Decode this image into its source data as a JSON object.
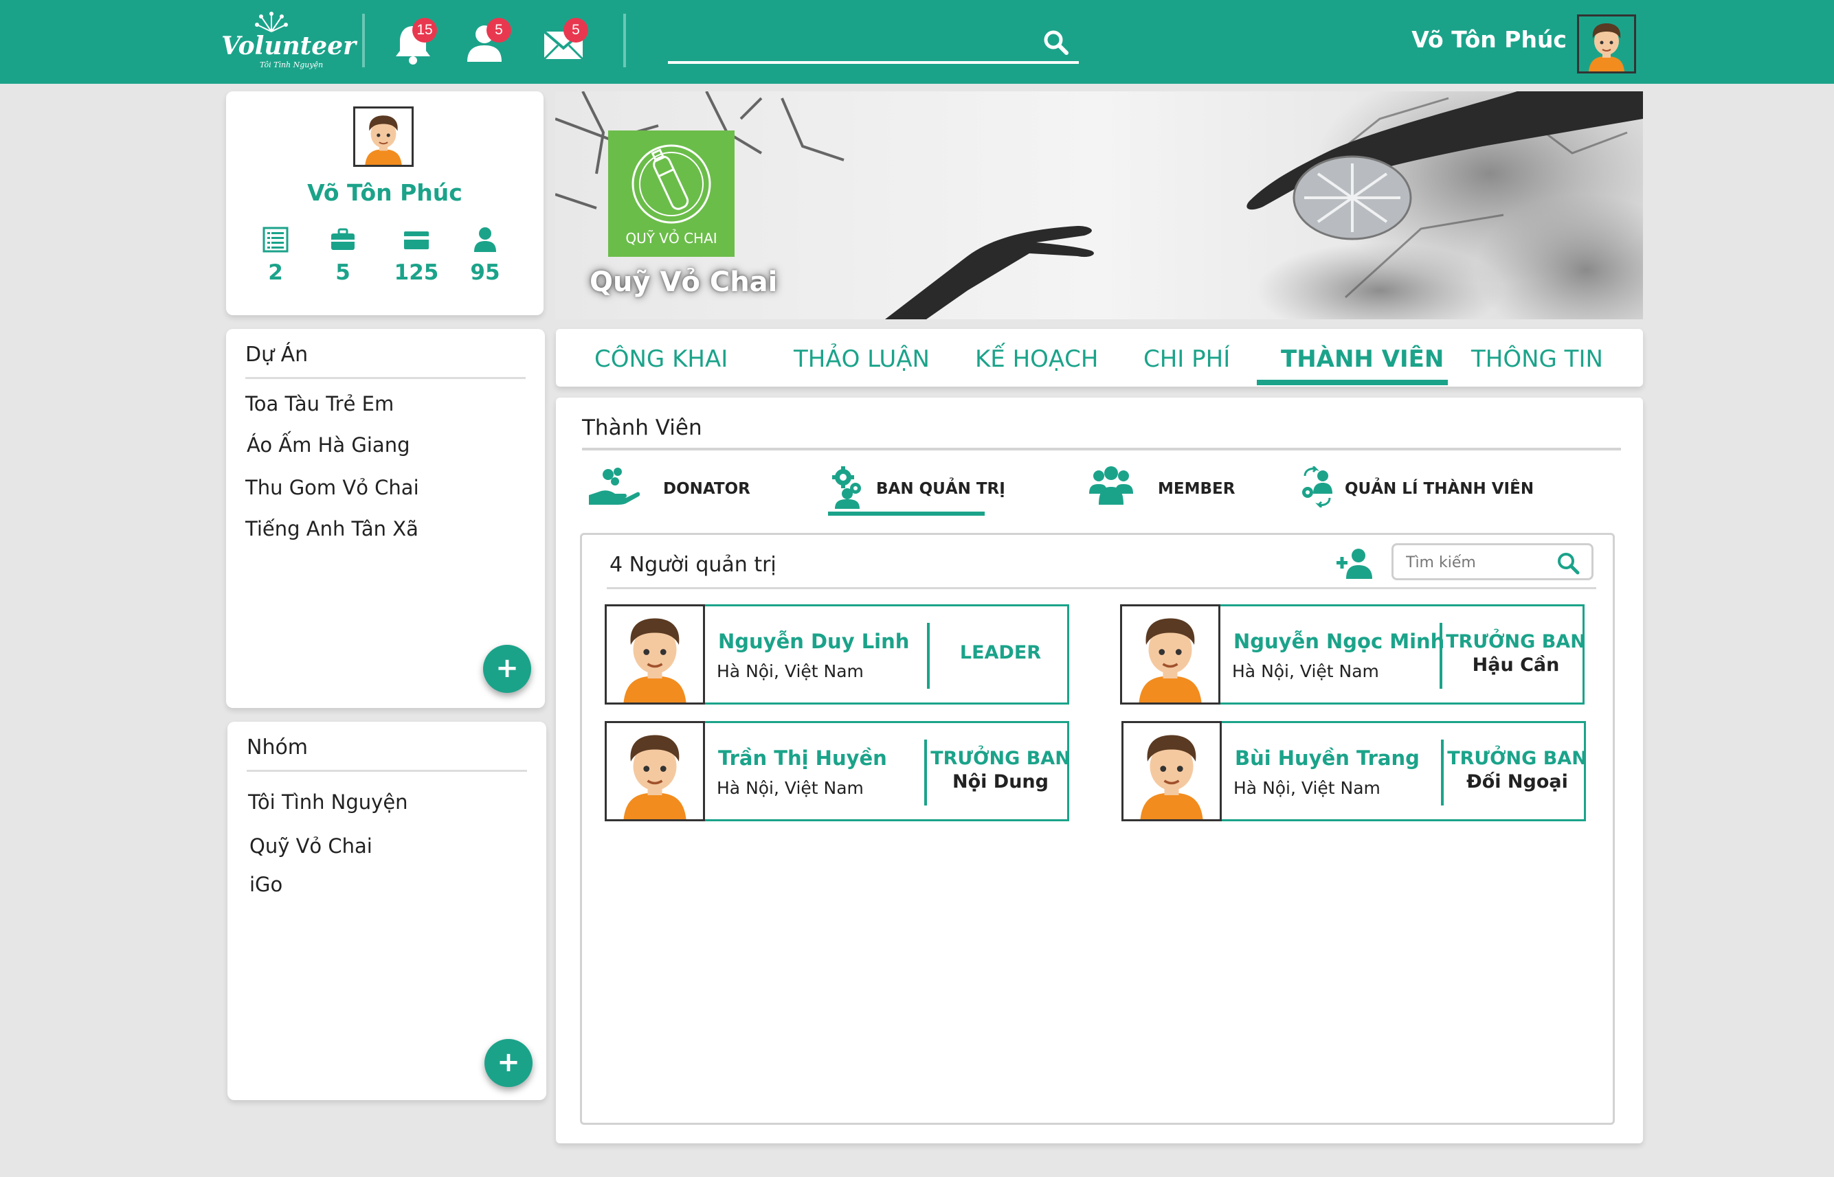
{
  "brand": {
    "logo_text": "Volunteer",
    "logo_subtitle": "Tôi Tình Nguyện"
  },
  "header": {
    "notifications_count": "15",
    "friend_requests_count": "5",
    "messages_count": "5",
    "search_placeholder": "",
    "username": "Võ Tôn Phúc"
  },
  "profile": {
    "name": "Võ Tôn Phúc",
    "stats": [
      {
        "icon": "list-icon",
        "value": "2"
      },
      {
        "icon": "briefcase-icon",
        "value": "5"
      },
      {
        "icon": "card-icon",
        "value": "125"
      },
      {
        "icon": "user-icon",
        "value": "95"
      }
    ]
  },
  "projects": {
    "title": "Dự Án",
    "items": [
      "Toa Tàu Trẻ Em",
      "Áo Ấm Hà Giang",
      "Thu Gom Vỏ Chai",
      "Tiếng Anh Tân Xã"
    ],
    "add_label": "+"
  },
  "groups": {
    "title": "Nhóm",
    "items": [
      "Tôi Tình Nguyện",
      "Quỹ Vỏ Chai",
      "iGo"
    ],
    "add_label": "+"
  },
  "group": {
    "name": "Quỹ Vỏ Chai",
    "logo_text": "QUỸ VỎ CHAI"
  },
  "tabs": [
    "CÔNG KHAI",
    "THẢO LUẬN",
    "KẾ HOẠCH",
    "CHI PHÍ",
    "THÀNH VIÊN",
    "THÔNG TIN"
  ],
  "active_tab": "THÀNH VIÊN",
  "members_panel": {
    "title": "Thành Viên",
    "subtabs": [
      "DONATOR",
      "BAN QUẢN TRỊ",
      "MEMBER",
      "QUẢN LÍ THÀNH VIÊN"
    ],
    "active_subtab": "BAN QUẢN TRỊ",
    "admin_count_label": "4 Người quản trị",
    "search_placeholder": "Tìm kiếm",
    "admins": [
      {
        "name": "Nguyễn Duy Linh",
        "location": "Hà Nội, Việt Nam",
        "role": "LEADER",
        "role_detail": ""
      },
      {
        "name": "Nguyễn Ngọc Minh",
        "location": "Hà Nội, Việt Nam",
        "role": "TRƯỞNG BAN",
        "role_detail": "Hậu Cần"
      },
      {
        "name": "Trần Thị Huyền",
        "location": "Hà Nội, Việt Nam",
        "role": "TRƯỞNG BAN",
        "role_detail": "Nội Dung"
      },
      {
        "name": "Bùi Huyền Trang",
        "location": "Hà Nội, Việt Nam",
        "role": "TRƯỞNG BAN",
        "role_detail": "Đối Ngoại"
      }
    ]
  },
  "colors": {
    "accent": "#1ba38a",
    "badge": "#e8384f",
    "background": "#e6e6e6",
    "group_logo": "#6bbd4a"
  }
}
